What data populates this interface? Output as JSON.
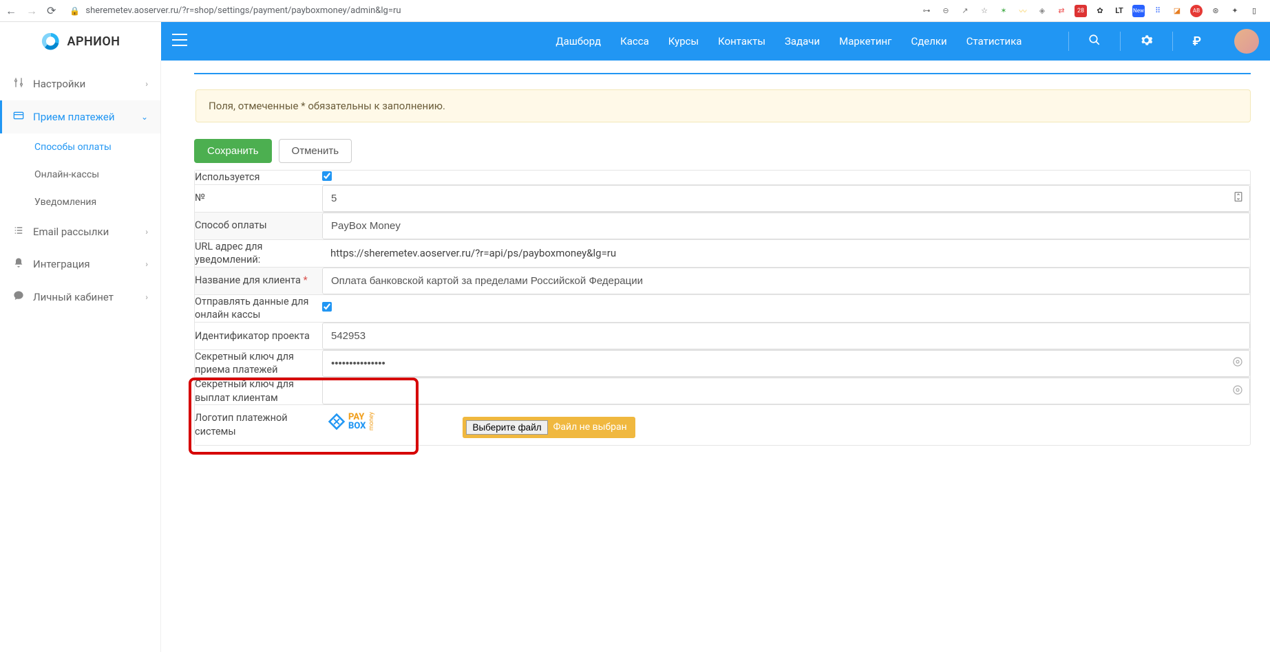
{
  "browser": {
    "url": "sheremetev.aoserver.ru/?r=shop/settings/payment/payboxmoney/admin&lg=ru"
  },
  "logo": {
    "text": "АРНИОН"
  },
  "nav": {
    "items": [
      "Дашборд",
      "Касса",
      "Курсы",
      "Контакты",
      "Задачи",
      "Маркетинг",
      "Сделки",
      "Статистика"
    ]
  },
  "sidebar": {
    "settings": "Настройки",
    "payments": "Прием платежей",
    "sub": [
      "Способы оплаты",
      "Онлайн-кассы",
      "Уведомления"
    ],
    "email": "Email рассылки",
    "integration": "Интеграция",
    "cabinet": "Личный кабинет"
  },
  "alert": "Поля, отмеченные * обязательны к заполнению.",
  "actions": {
    "save": "Сохранить",
    "cancel": "Отменить"
  },
  "form": {
    "used_lbl": "Используется",
    "num_lbl": "№",
    "num_val": "5",
    "method_lbl": "Способ оплаты",
    "method_val": "PayBox Money",
    "url_lbl": "URL адрес для уведомлений:",
    "url_val": "https://sheremetev.aoserver.ru/?r=api/ps/payboxmoney&lg=ru",
    "client_name_lbl": "Название для клиента",
    "client_name_val": "Оплата банковской картой за пределами Российской Федерации",
    "send_kassa_lbl": "Отправлять данные для онлайн кассы",
    "project_id_lbl": "Идентификатор проекта",
    "project_id_val": "542953",
    "secret_in_lbl": "Секретный ключ для приема платежей",
    "secret_in_val": "•••••••••••••••",
    "secret_out_lbl": "Секретный ключ для выплат клиентам",
    "secret_out_val": "",
    "logo_lbl": "Логотип платежной системы",
    "file_btn": "Выберите файл",
    "file_status": "Файл не выбран"
  }
}
